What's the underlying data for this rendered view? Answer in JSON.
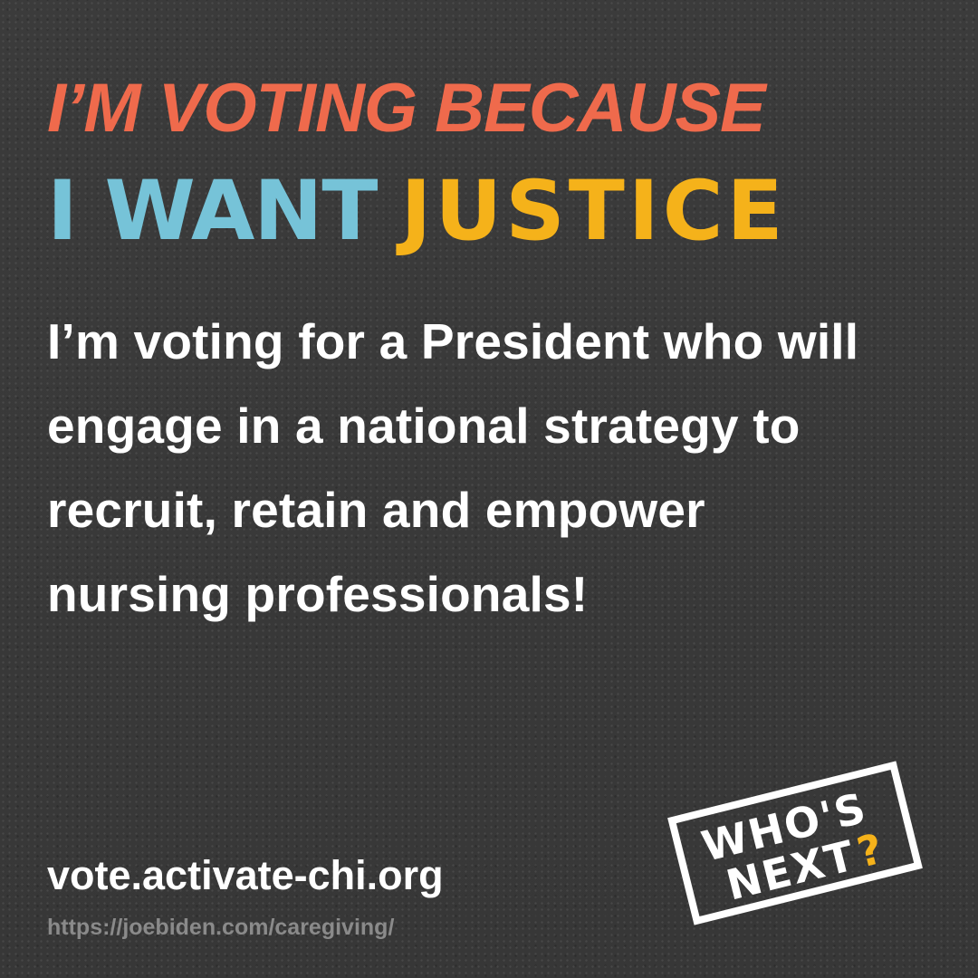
{
  "colors": {
    "background": "#393939",
    "eyebrow": "#ef6a4c",
    "want": "#76c3d8",
    "justice": "#f5b21a",
    "body_text": "#ffffff",
    "muted_text": "#8a8a8a"
  },
  "header": {
    "eyebrow": "I’M VOTING BECAUSE",
    "want": "I WANT",
    "cause": "JUSTICE"
  },
  "message": {
    "line_1": "I’m voting for a President who will",
    "line_2": "engage in a national strategy to",
    "line_3": "recruit, retain and empower",
    "line_4": "nursing professionals!"
  },
  "footer": {
    "site": "vote.activate-chi.org",
    "source": "https://joebiden.com/caregiving/"
  },
  "stamp": {
    "line_1": "WHO'S",
    "line_2": "NEXT",
    "mark": "?"
  }
}
